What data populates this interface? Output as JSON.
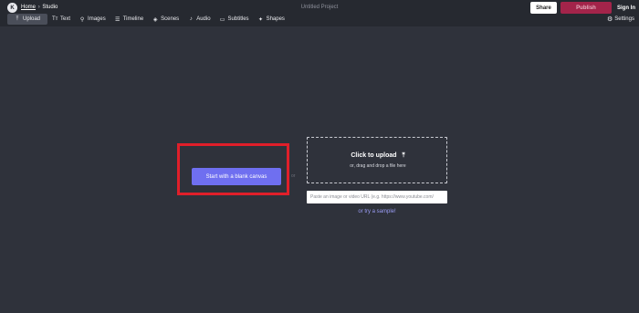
{
  "header": {
    "logo_text": "K",
    "breadcrumb": {
      "home": "Home",
      "separator": "›",
      "current": "Studio"
    },
    "project_title": "Untitled Project",
    "share_label": "Share",
    "publish_label": "Publish",
    "signin_label": "Sign In"
  },
  "toolbar": {
    "items": [
      {
        "label": "Upload",
        "icon": "upload-icon",
        "glyph": "⤒",
        "active": true
      },
      {
        "label": "Text",
        "icon": "text-icon",
        "glyph": "Tт"
      },
      {
        "label": "Images",
        "icon": "search-icon",
        "glyph": "⚲"
      },
      {
        "label": "Timeline",
        "icon": "timeline-icon",
        "glyph": "☰"
      },
      {
        "label": "Scenes",
        "icon": "layers-icon",
        "glyph": "◈"
      },
      {
        "label": "Audio",
        "icon": "music-note-icon",
        "glyph": "♪"
      },
      {
        "label": "Subtitles",
        "icon": "subtitles-icon",
        "glyph": "▭"
      },
      {
        "label": "Shapes",
        "icon": "shapes-icon",
        "glyph": "✦"
      }
    ],
    "settings_label": "Settings",
    "settings_glyph": "⚙"
  },
  "main": {
    "blank_canvas_label": "Start with a blank canvas",
    "or_label": "or",
    "upload_title": "Click to upload",
    "upload_glyph": "⤒",
    "upload_subtitle": "or, drag and drop a file here",
    "url_placeholder": "Paste an image or video URL (e.g. https://www.youtube.com/",
    "sample_link": "or try a sample!"
  },
  "colors": {
    "background": "#2f323b",
    "topbar": "#262930",
    "accent": "#6f6ff0",
    "publish": "#a3244a",
    "highlight": "#e01f2a"
  }
}
